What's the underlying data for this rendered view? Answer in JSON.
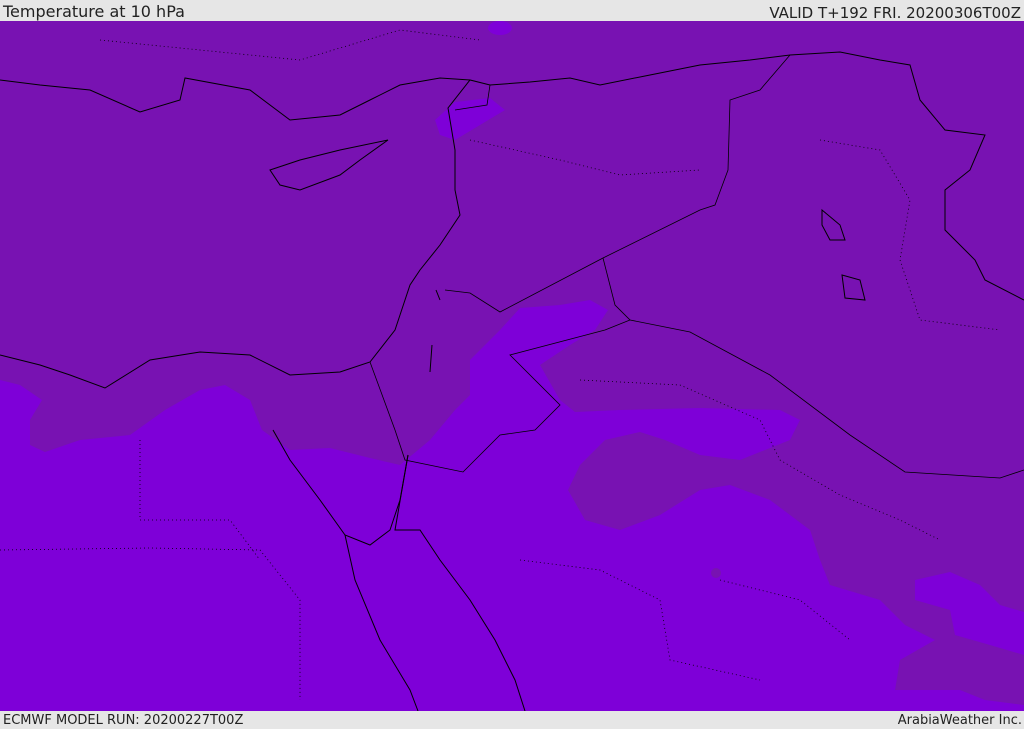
{
  "header": {
    "title": "Temperature at 10 hPa",
    "valid": "VALID T+192 FRI. 20200306T00Z"
  },
  "footer": {
    "model_run": "ECMWF MODEL RUN: 20200227T00Z",
    "credit": "ArabiaWeather Inc."
  },
  "colors": {
    "warm_band": "#7812b2",
    "cold_band": "#7e00d8",
    "coastline": "#000000",
    "bar_bg": "#e6e6e6"
  }
}
